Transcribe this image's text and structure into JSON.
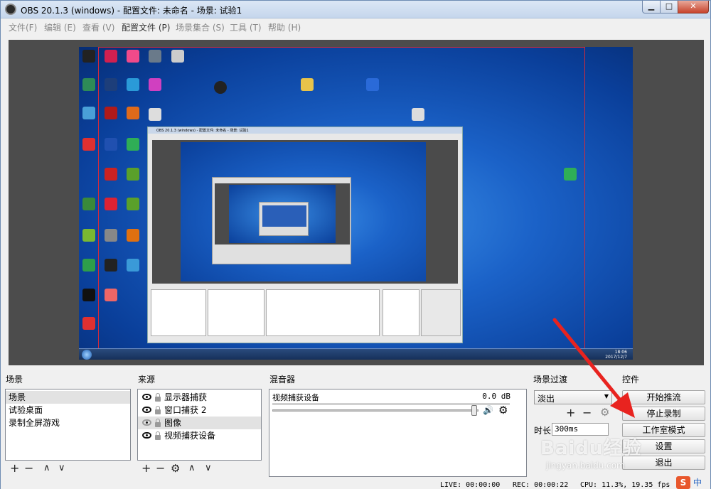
{
  "window": {
    "title": "OBS 20.1.3 (windows) - 配置文件: 未命名 - 场景: 试验1",
    "minimize": "▁",
    "maximize": "□",
    "close": "✕"
  },
  "menu": [
    {
      "label": "文件(F)"
    },
    {
      "label": "编辑 (E)"
    },
    {
      "label": "查看 (V)"
    },
    {
      "label": "配置文件 (P)"
    },
    {
      "label": "场景集合 (S)"
    },
    {
      "label": "工具 (T)"
    },
    {
      "label": "帮助 (H)"
    }
  ],
  "preview": {
    "clock": "18:06\n2017/12/7",
    "nested_title": "OBS 20.1.3 (windows) - 配置文件: 未命名 - 场景: 试验1"
  },
  "scenes": {
    "header": "场景",
    "items": [
      "场景",
      "试验桌面",
      "录制全屏游戏"
    ],
    "selected": 0
  },
  "sources": {
    "header": "来源",
    "items": [
      {
        "label": "显示器捕获",
        "visible": true
      },
      {
        "label": "窗口捕获 2",
        "visible": true
      },
      {
        "label": "图像",
        "visible": false
      },
      {
        "label": "视频捕获设备",
        "visible": true
      }
    ],
    "selected": 2
  },
  "mixer": {
    "header": "混音器",
    "channel": "视频捕获设备",
    "level": "0.0 dB",
    "volume_fraction": 0.98
  },
  "transitions": {
    "header": "场景过渡",
    "selected": "淡出",
    "duration_label": "时长",
    "duration_value": "300ms"
  },
  "controls": {
    "header": "控件",
    "buttons": [
      "开始推流",
      "停止录制",
      "工作室模式",
      "设置",
      "退出"
    ]
  },
  "status": {
    "live": "LIVE: 00:00:00",
    "rec": "REC: 00:00:22",
    "cpu": "CPU: 11.3%, 19.35 fps"
  },
  "watermark": {
    "brand": "Baidu经验",
    "url": "jingyan.baidu.com"
  },
  "ime": {
    "logo": "S",
    "mode": "中"
  },
  "colors": {
    "annotation_arrow": "#e8231f",
    "selection_box": "#d42a3a"
  },
  "icons": {
    "add": "+",
    "remove": "−",
    "up": "∧",
    "down": "∨",
    "settings": "⚙",
    "speaker": "🔊",
    "dropdown": "▼"
  }
}
